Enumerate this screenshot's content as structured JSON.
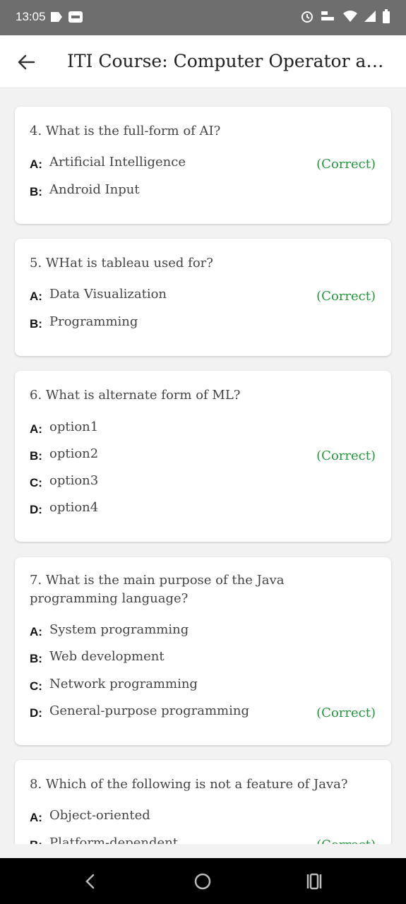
{
  "status_bar": {
    "time": "13:05"
  },
  "app_bar": {
    "title": "ITI Course: Computer Operator and..."
  },
  "questions": [
    {
      "question": "4. What is the full-form of AI?",
      "options": [
        {
          "key": "A:",
          "text": "Artificial Intelligence",
          "correct": true
        },
        {
          "key": "B:",
          "text": "Android Input",
          "correct": false
        }
      ]
    },
    {
      "question": "5. WHat is tableau used for?",
      "options": [
        {
          "key": "A:",
          "text": "Data Visualization",
          "correct": true
        },
        {
          "key": "B:",
          "text": "Programming",
          "correct": false
        }
      ]
    },
    {
      "question": "6. What is alternate form of ML?",
      "options": [
        {
          "key": "A:",
          "text": "option1",
          "correct": false
        },
        {
          "key": "B:",
          "text": "option2",
          "correct": true
        },
        {
          "key": "C:",
          "text": "option3",
          "correct": false
        },
        {
          "key": "D:",
          "text": "option4",
          "correct": false
        }
      ]
    },
    {
      "question": "7. What is the main purpose of the Java programming language?",
      "options": [
        {
          "key": "A:",
          "text": "System programming",
          "correct": false
        },
        {
          "key": "B:",
          "text": "Web development",
          "correct": false
        },
        {
          "key": "C:",
          "text": "Network programming",
          "correct": false
        },
        {
          "key": "D:",
          "text": "General-purpose programming",
          "correct": true
        }
      ]
    },
    {
      "question": "8. Which of the following is not a feature of Java?",
      "options": [
        {
          "key": "A:",
          "text": "Object-oriented",
          "correct": false
        },
        {
          "key": "B:",
          "text": "Platform-dependent",
          "correct": true
        }
      ]
    }
  ],
  "correct_label": "(Correct)",
  "colors": {
    "correct": "#22973a",
    "status_bar": "#6e6e6e",
    "nav_bar": "#000000"
  },
  "icons": {
    "back": "arrow-left-icon",
    "nav_back": "nav-back-icon",
    "nav_home": "nav-home-icon",
    "nav_recents": "nav-recents-icon"
  }
}
